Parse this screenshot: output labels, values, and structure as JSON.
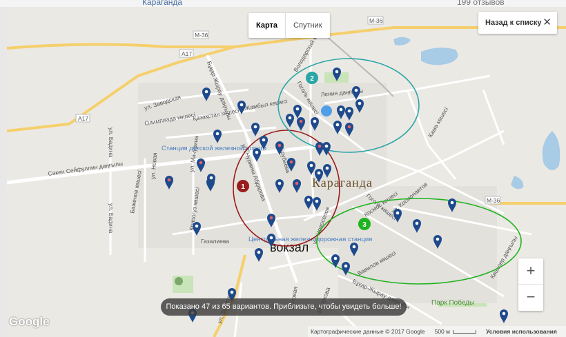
{
  "header": {
    "place_link": "Караганда",
    "reviews": "199 отзывов"
  },
  "map_type": {
    "map": "Карта",
    "satellite": "Спутник"
  },
  "back_button": {
    "label": "Назад к списку",
    "close_glyph": "✕"
  },
  "zoom": {
    "in_glyph": "+",
    "out_glyph": "−"
  },
  "status_toast": "Показано 47 из 65 вариантов. Приблизьте, чтобы увидеть больше!",
  "google_logo": "Google",
  "attribution": {
    "map_data": "Картографические данные © 2017 Google",
    "scale": "500 м",
    "terms": "Условия использования"
  },
  "city_label": "Караганда",
  "annotation_text": "вокзал",
  "clusters": [
    {
      "number": "1",
      "color": "#9b1c1c"
    },
    {
      "number": "2",
      "color": "#2aa6a6"
    },
    {
      "number": "3",
      "color": "#1fb31f"
    }
  ],
  "colors": {
    "marker": "#1e4a8c",
    "marker_dot_white": "#ffffff",
    "marker_dot_red": "#e4606d",
    "road": "#ffffff",
    "highway": "#f5cf6b",
    "water": "#a8cbe6",
    "park": "#c9e4b8"
  },
  "road_labels": {
    "m36_a": "M-36",
    "m36_b": "M-36",
    "m36_c": "M-36",
    "a17_a": "A17",
    "a17_b": "A17",
    "zavodskaya": "ул. Заводская",
    "olimpiada": "Олимпиада көшесі",
    "kazakhstan": "Қазақстан көшесі",
    "zhambyl": "Жамбыл көшесі",
    "seifullin": "Сәкен Сейфуллин даңғылы",
    "badina_1": "ул. Бадина",
    "badina_2": "ул. Бадина",
    "novaya": "ул. Новая",
    "bazhenov": "Баженов көшесі",
    "michurina": "ул. Мичурина",
    "krivogyz": "Кривогуз көшесі",
    "gazalieva": "Газалиева",
    "bukhar_zhyrau": "Бұқар Жырау даңғылы",
    "bukhar_zhyrau_2": "Бұқар-Жырау даңғылы",
    "lenin": "Ленин даңғылы",
    "gogol_1": "Гоголь көшесі",
    "gogol_2": "Гоголь көшесі",
    "volodarsky": "Володарский көшесі",
    "erubayeva": "Ерубаева",
    "nurken": "ул. Нуркена Абдирова",
    "novoselov": "ул. Новоселов",
    "kosmonavtov": "ул. Космонавтов",
    "vavilova": "Вавилов көшесі",
    "kosmos": "Космос көшесі",
    "keshiler": "Көшілер даңғылы",
    "kama": "Кама көшесі",
    "molokova": "Молокова",
    "bytovaya": "Бытовая",
    "zashitnaya": "ул. Защитная"
  },
  "poi": {
    "station_detskoy": "Станция детской железной дороги",
    "central_station": "Центральная железнодорожная станция",
    "park_pobedy": "Парк Победы"
  }
}
